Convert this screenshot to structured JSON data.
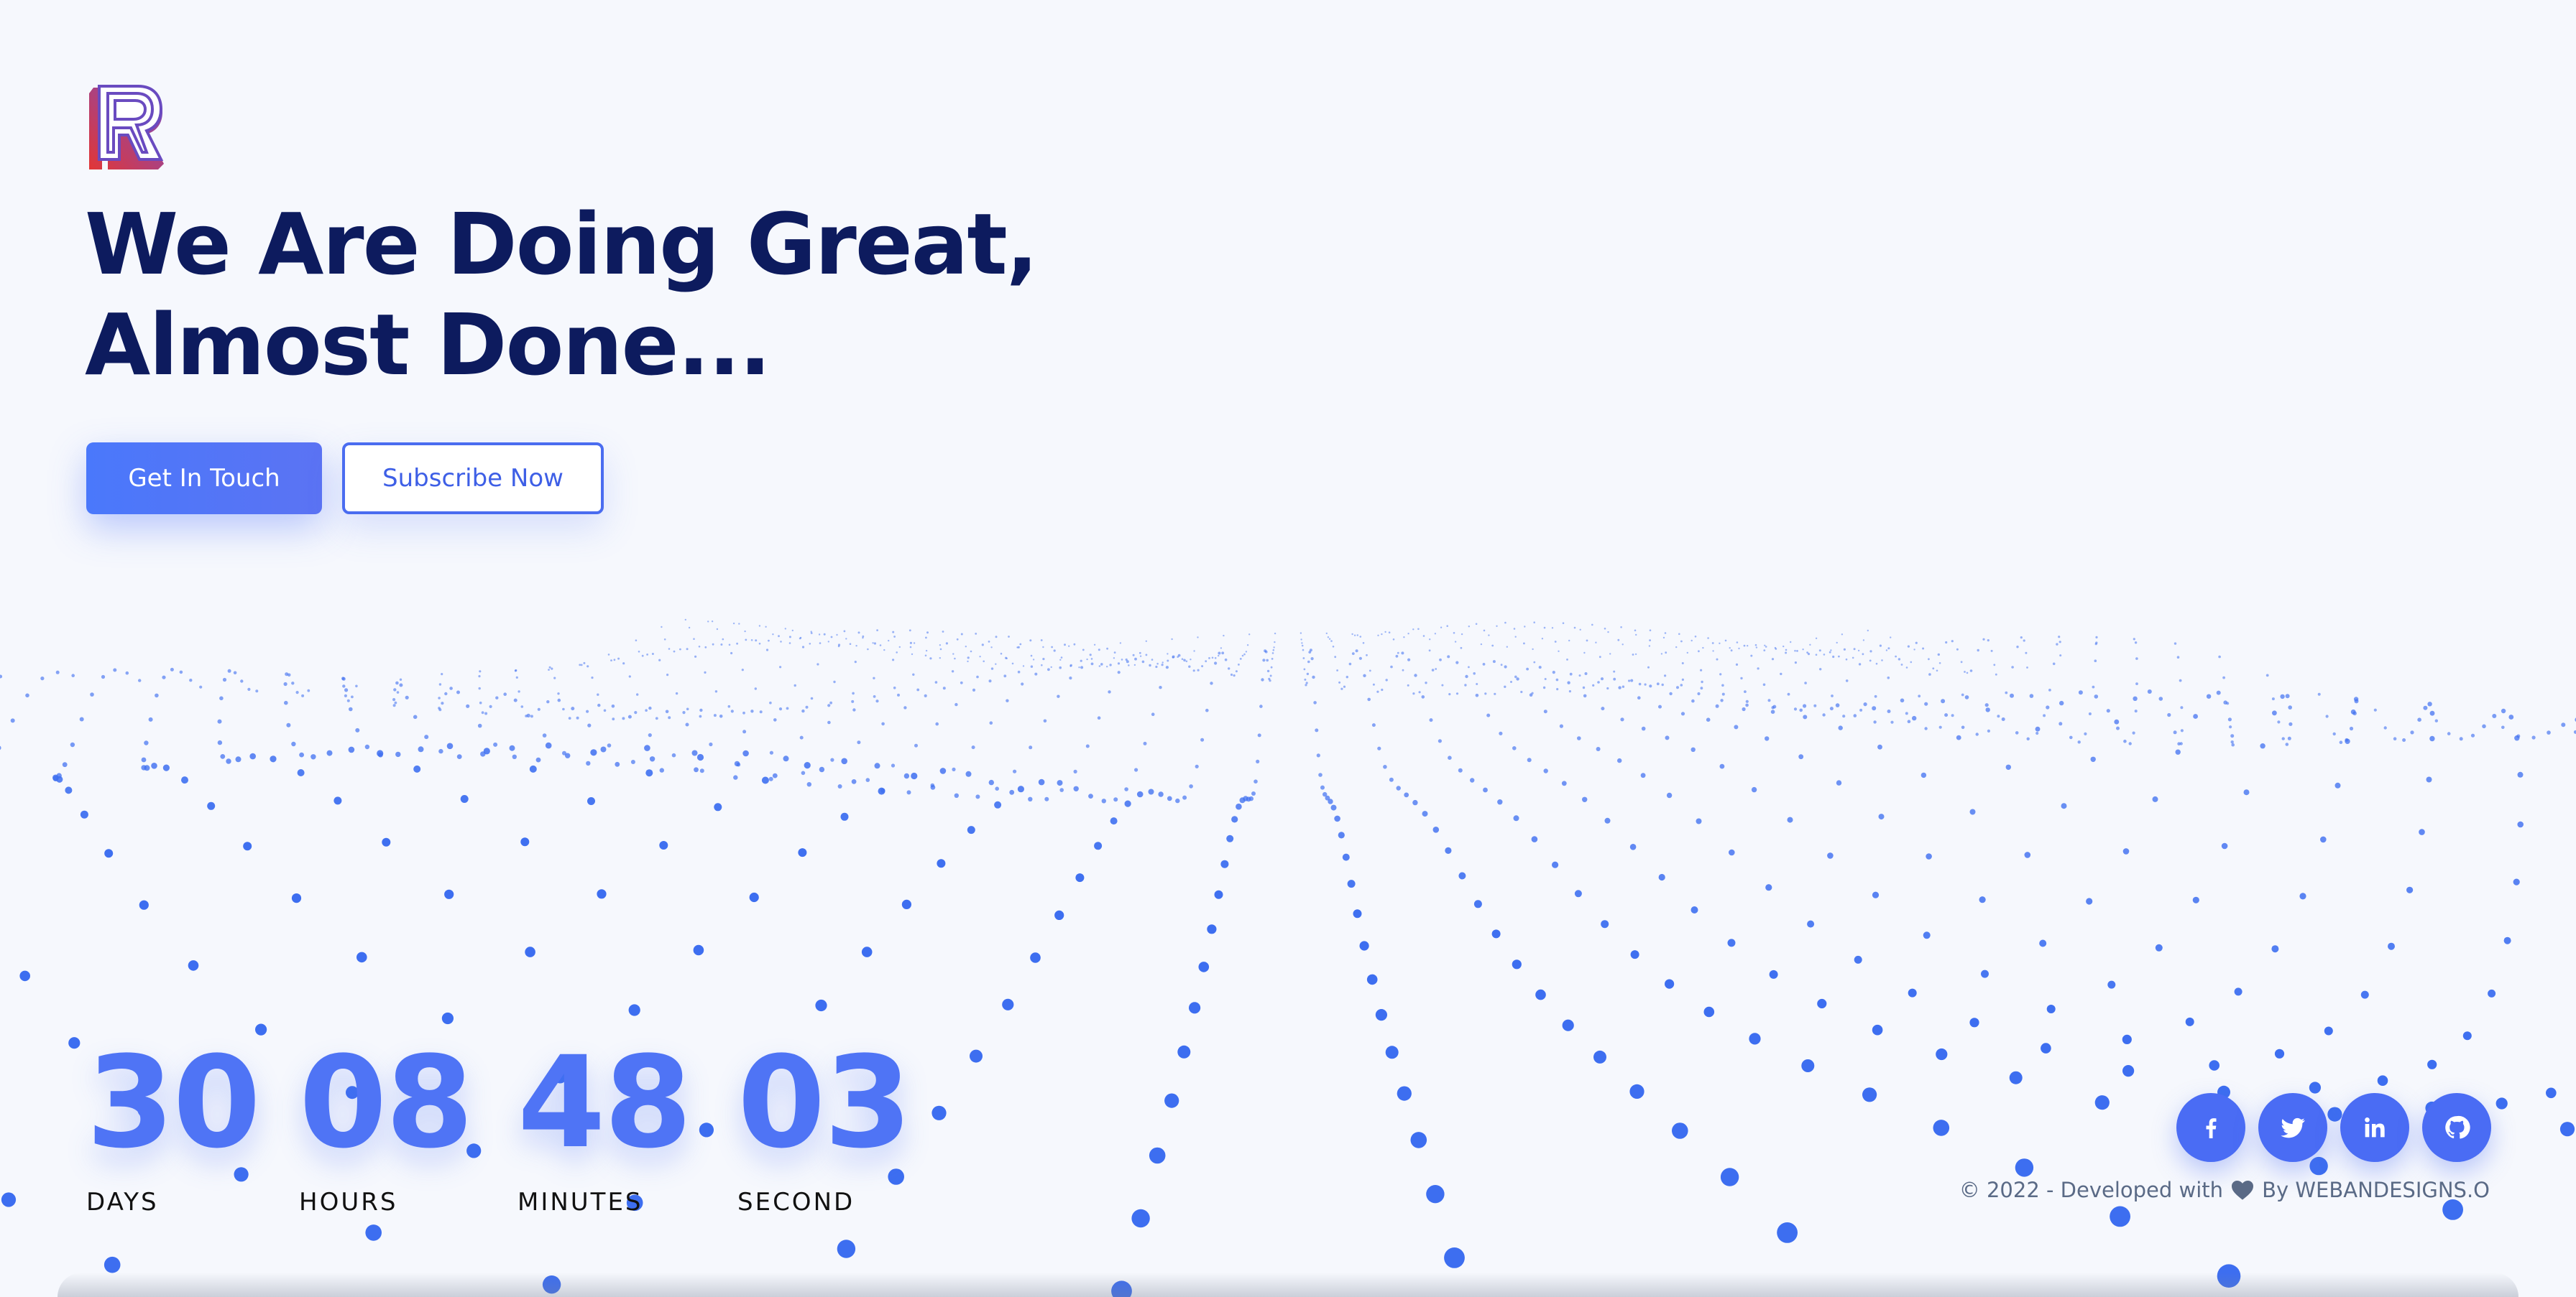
{
  "brand": {
    "logo_letter": "R",
    "colors": {
      "primary": "#4a6cf4",
      "heading": "#0d1b5e",
      "logo_red": "#e03a3a",
      "logo_purple": "#6b4fb8"
    }
  },
  "hero": {
    "headline_line1": "We Are Doing Great,",
    "headline_line2": "Almost Done..."
  },
  "buttons": {
    "primary_label": "Get In Touch",
    "secondary_label": "Subscribe Now"
  },
  "countdown": [
    {
      "value": "30",
      "label": "DAYS"
    },
    {
      "value": "08",
      "label": "HOURS"
    },
    {
      "value": "48",
      "label": "MINUTES"
    },
    {
      "value": "03",
      "label": "SECOND"
    }
  ],
  "social": [
    {
      "icon": "facebook-icon"
    },
    {
      "icon": "twitter-icon"
    },
    {
      "icon": "linkedin-icon"
    },
    {
      "icon": "github-icon"
    }
  ],
  "footer": {
    "prefix": "© 2022 - Developed with",
    "suffix": "By WEBANDESIGNS.O",
    "heart_icon": "heart-icon"
  }
}
